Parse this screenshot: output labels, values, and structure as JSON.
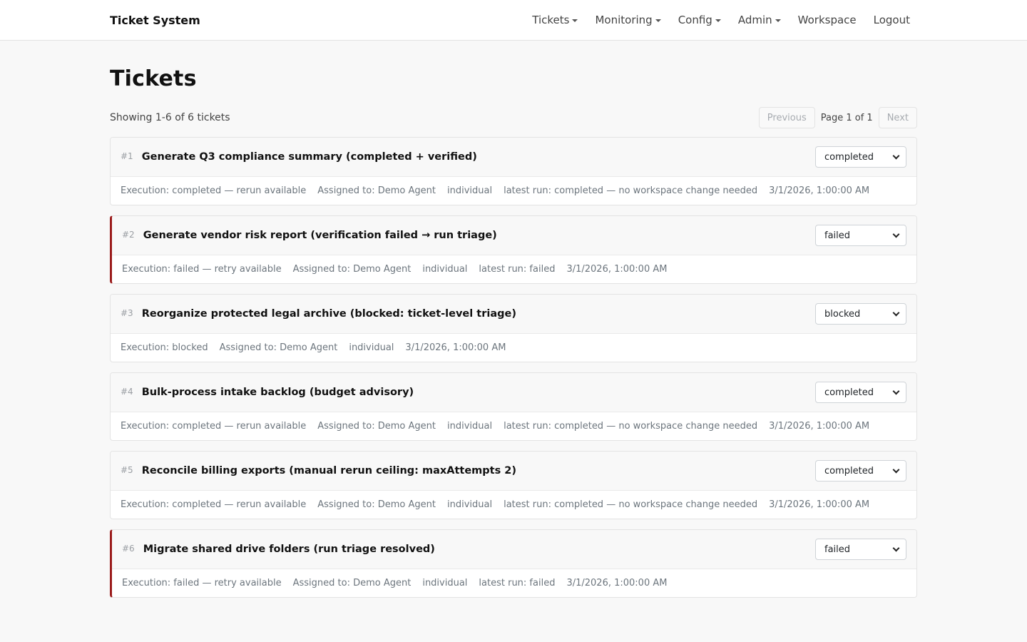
{
  "brand": "Ticket System",
  "nav": [
    {
      "label": "Tickets",
      "dropdown": true
    },
    {
      "label": "Monitoring",
      "dropdown": true
    },
    {
      "label": "Config",
      "dropdown": true
    },
    {
      "label": "Admin",
      "dropdown": true
    },
    {
      "label": "Workspace",
      "dropdown": false
    },
    {
      "label": "Logout",
      "dropdown": false
    }
  ],
  "page_title": "Tickets",
  "showing": "Showing 1-6 of 6 tickets",
  "pager": {
    "previous": "Previous",
    "page_info": "Page 1 of 1",
    "next": "Next"
  },
  "colors": {
    "failed_accent": "#9b1c1c",
    "background": "#f8f8f8"
  },
  "tickets": [
    {
      "id": "#1",
      "title": "Generate Q3 compliance summary (completed + verified)",
      "status": "completed",
      "highlight": false,
      "meta": [
        "Execution: completed — rerun available",
        "Assigned to: Demo Agent",
        "individual",
        "latest run: completed — no workspace change needed",
        "3/1/2026, 1:00:00 AM"
      ]
    },
    {
      "id": "#2",
      "title": "Generate vendor risk report (verification failed → run triage)",
      "status": "failed",
      "highlight": true,
      "meta": [
        "Execution: failed — retry available",
        "Assigned to: Demo Agent",
        "individual",
        "latest run: failed",
        "3/1/2026, 1:00:00 AM"
      ]
    },
    {
      "id": "#3",
      "title": "Reorganize protected legal archive (blocked: ticket-level triage)",
      "status": "blocked",
      "highlight": false,
      "meta": [
        "Execution: blocked",
        "Assigned to: Demo Agent",
        "individual",
        "3/1/2026, 1:00:00 AM"
      ]
    },
    {
      "id": "#4",
      "title": "Bulk-process intake backlog (budget advisory)",
      "status": "completed",
      "highlight": false,
      "meta": [
        "Execution: completed — rerun available",
        "Assigned to: Demo Agent",
        "individual",
        "latest run: completed — no workspace change needed",
        "3/1/2026, 1:00:00 AM"
      ]
    },
    {
      "id": "#5",
      "title": "Reconcile billing exports (manual rerun ceiling: maxAttempts 2)",
      "status": "completed",
      "highlight": false,
      "meta": [
        "Execution: completed — rerun available",
        "Assigned to: Demo Agent",
        "individual",
        "latest run: completed — no workspace change needed",
        "3/1/2026, 1:00:00 AM"
      ]
    },
    {
      "id": "#6",
      "title": "Migrate shared drive folders (run triage resolved)",
      "status": "failed",
      "highlight": true,
      "meta": [
        "Execution: failed — retry available",
        "Assigned to: Demo Agent",
        "individual",
        "latest run: failed",
        "3/1/2026, 1:00:00 AM"
      ]
    }
  ]
}
